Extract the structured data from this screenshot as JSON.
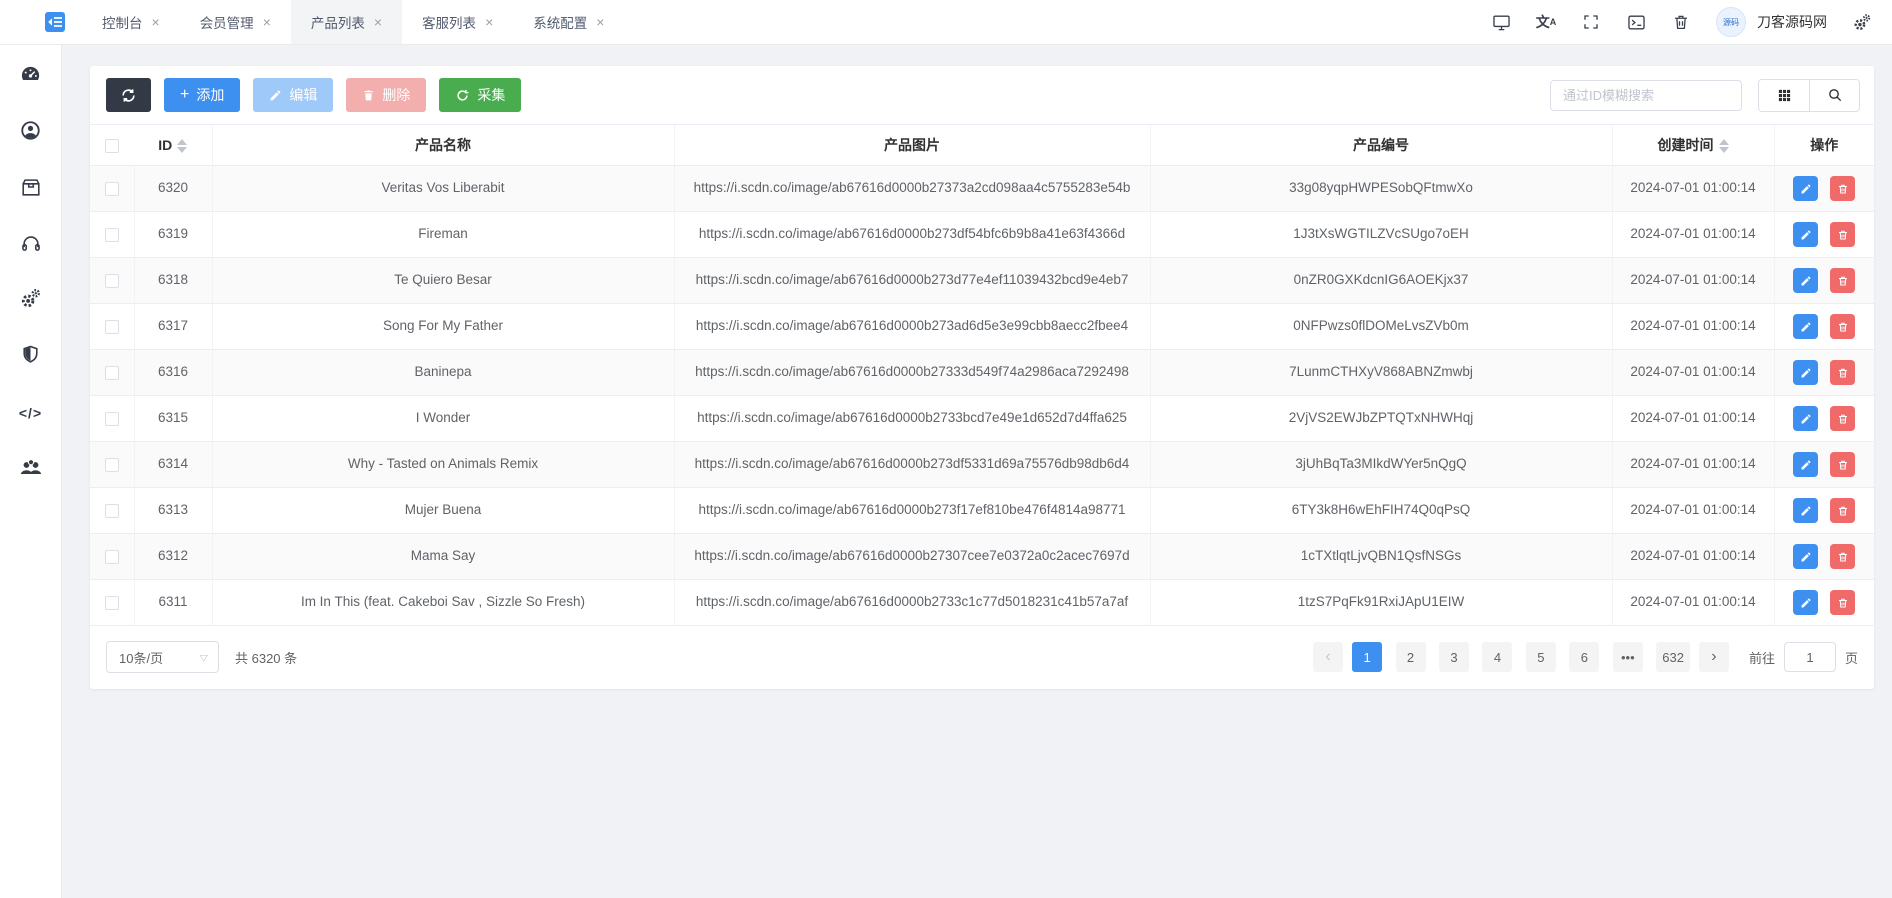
{
  "app": {
    "user_name": "刀客源码网"
  },
  "tabs": [
    {
      "label": "控制台",
      "active": false
    },
    {
      "label": "会员管理",
      "active": false
    },
    {
      "label": "产品列表",
      "active": true
    },
    {
      "label": "客服列表",
      "active": false
    },
    {
      "label": "系统配置",
      "active": false
    }
  ],
  "toolbar": {
    "add_label": "添加",
    "edit_label": "编辑",
    "delete_label": "删除",
    "collect_label": "采集",
    "search_placeholder": "通过ID模糊搜索"
  },
  "table": {
    "columns": [
      {
        "label": "ID",
        "sortable": true
      },
      {
        "label": "产品名称",
        "sortable": false
      },
      {
        "label": "产品图片",
        "sortable": false
      },
      {
        "label": "产品编号",
        "sortable": false
      },
      {
        "label": "创建时间",
        "sortable": true
      },
      {
        "label": "操作",
        "sortable": false
      }
    ],
    "rows": [
      {
        "id": "6320",
        "name": "Veritas Vos Liberabit",
        "image": "https://i.scdn.co/image/ab67616d0000b27373a2cd098aa4c5755283e54b",
        "code": "33g08yqpHWPESobQFtmwXo",
        "created": "2024-07-01 01:00:14"
      },
      {
        "id": "6319",
        "name": "Fireman",
        "image": "https://i.scdn.co/image/ab67616d0000b273df54bfc6b9b8a41e63f4366d",
        "code": "1J3tXsWGTILZVcSUgo7oEH",
        "created": "2024-07-01 01:00:14"
      },
      {
        "id": "6318",
        "name": "Te Quiero Besar",
        "image": "https://i.scdn.co/image/ab67616d0000b273d77e4ef11039432bcd9e4eb7",
        "code": "0nZR0GXKdcnIG6AOEKjx37",
        "created": "2024-07-01 01:00:14"
      },
      {
        "id": "6317",
        "name": "Song For My Father",
        "image": "https://i.scdn.co/image/ab67616d0000b273ad6d5e3e99cbb8aecc2fbee4",
        "code": "0NFPwzs0flDOMeLvsZVb0m",
        "created": "2024-07-01 01:00:14"
      },
      {
        "id": "6316",
        "name": "Baninepa",
        "image": "https://i.scdn.co/image/ab67616d0000b27333d549f74a2986aca7292498",
        "code": "7LunmCTHXyV868ABNZmwbj",
        "created": "2024-07-01 01:00:14"
      },
      {
        "id": "6315",
        "name": "I Wonder",
        "image": "https://i.scdn.co/image/ab67616d0000b2733bcd7e49e1d652d7d4ffa625",
        "code": "2VjVS2EWJbZPTQTxNHWHqj",
        "created": "2024-07-01 01:00:14"
      },
      {
        "id": "6314",
        "name": "Why - Tasted on Animals Remix",
        "image": "https://i.scdn.co/image/ab67616d0000b273df5331d69a75576db98db6d4",
        "code": "3jUhBqTa3MIkdWYer5nQgQ",
        "created": "2024-07-01 01:00:14"
      },
      {
        "id": "6313",
        "name": "Mujer Buena",
        "image": "https://i.scdn.co/image/ab67616d0000b273f17ef810be476f4814a98771",
        "code": "6TY3k8H6wEhFIH74Q0qPsQ",
        "created": "2024-07-01 01:00:14"
      },
      {
        "id": "6312",
        "name": "Mama Say",
        "image": "https://i.scdn.co/image/ab67616d0000b27307cee7e0372a0c2acec7697d",
        "code": "1cTXtlqtLjvQBN1QsfNSGs",
        "created": "2024-07-01 01:00:14"
      },
      {
        "id": "6311",
        "name": "Im In This (feat. Cakeboi Sav , Sizzle So Fresh)",
        "image": "https://i.scdn.co/image/ab67616d0000b2733c1c77d5018231c41b57a7af",
        "code": "1tzS7PqFk91RxiJApU1EIW",
        "created": "2024-07-01 01:00:14"
      }
    ]
  },
  "pagination": {
    "page_size": "10条/页",
    "total_text": "共 6320 条",
    "pages": [
      {
        "label": "1",
        "active": true
      },
      {
        "label": "2",
        "active": false
      },
      {
        "label": "3",
        "active": false
      },
      {
        "label": "4",
        "active": false
      },
      {
        "label": "5",
        "active": false
      },
      {
        "label": "6",
        "active": false
      },
      {
        "label": "•••",
        "active": false
      },
      {
        "label": "632",
        "active": false
      }
    ],
    "prev_label": "‹",
    "next_label": "›",
    "goto_label": "前往",
    "goto_value": "1",
    "unit_label": "页"
  },
  "colors": {
    "accent": "#3d8ff0",
    "success": "#49ad50",
    "danger": "#f06a6a",
    "edit_disabled": "#9fc9f8",
    "delete_disabled": "#f3aeae",
    "dark_button": "#333a45",
    "content_background": "#f0f2f5"
  }
}
